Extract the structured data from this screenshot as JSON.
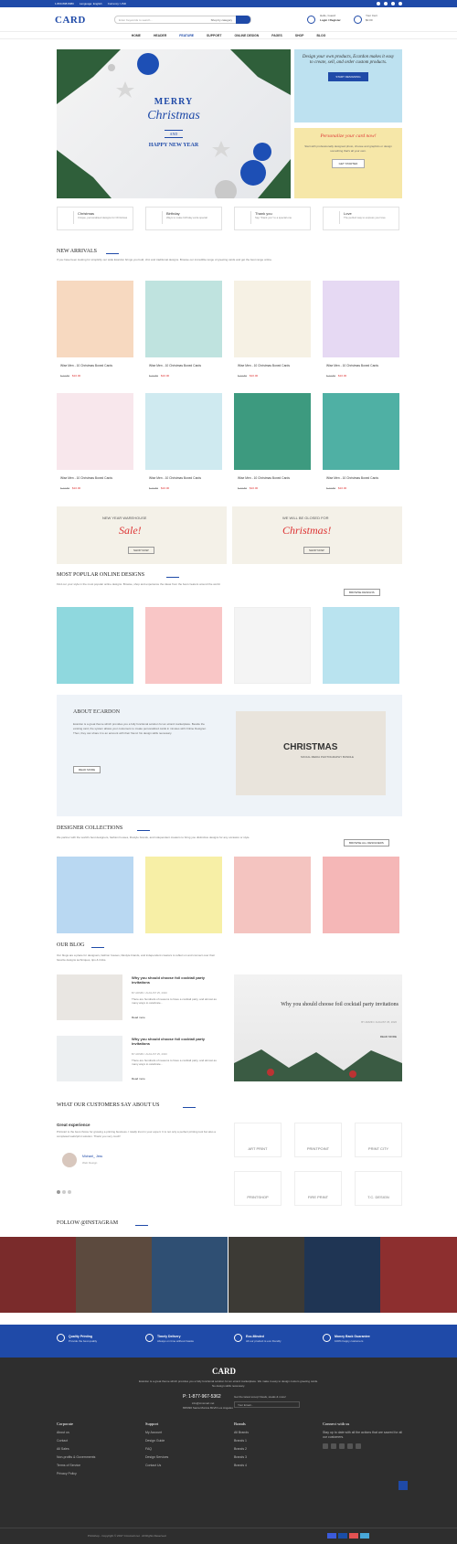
{
  "topbar": {
    "phone": "1.800.808.8080",
    "language": "Language: English",
    "currency": "Currency: USD"
  },
  "header": {
    "logo": "CARD",
    "search_placeholder": "Enter Keywords to search...",
    "category": "Shop by category",
    "account_hello": "Hello, Guest!",
    "account_links": "Login / Register",
    "cart_label": "Your Cart",
    "cart_total": "$0.00"
  },
  "nav": [
    "HOME",
    "HEADER",
    "FEATURE",
    "SUPPORT",
    "ONLINE DESIGN",
    "PAGES",
    "SHOP",
    "BLOG"
  ],
  "hero": {
    "title1": "MERRY",
    "title2": "Christmas",
    "title3": "AND",
    "title4": "HAPPY NEW YEAR"
  },
  "promo1": {
    "heading": "Design your own products, Ecardon makes it easy to create, sell, and order custom products.",
    "button": "START DESIGNING"
  },
  "promo2": {
    "heading": "Personalize your card now!",
    "text": "Start with professionally designed photo, choose and graphics or design something that's all your own.",
    "button": "GET STARTED"
  },
  "features": [
    {
      "title": "Christmas",
      "text": "Unique, personalised designs for Christmas"
    },
    {
      "title": "Birthday",
      "text": "Ways to make birthday extra special"
    },
    {
      "title": "Thank you",
      "text": "Say \"thank you\" to a special one"
    },
    {
      "title": "Love",
      "text": "The perfect way to express your love"
    }
  ],
  "new_arrivals": {
    "title": "NEW ARRIVALS",
    "desc": "If you have been looking for simplicity our wide Ecardon brings you bold, chic and traditional designs. Browse our incredible range of greeting cards and get the best range online."
  },
  "products": [
    {
      "title": "Wise Men - 10 Christmas Boxed Cards",
      "old": "$ 12.80",
      "price": "$10.00"
    },
    {
      "title": "Wise Men - 10 Christmas Boxed Cards",
      "old": "$ 12.80",
      "price": "$10.00"
    },
    {
      "title": "Wise Men - 10 Christmas Boxed Cards",
      "old": "$ 12.80",
      "price": "$10.00"
    },
    {
      "title": "Wise Men - 10 Christmas Boxed Cards",
      "old": "$ 12.80",
      "price": "$10.00"
    },
    {
      "title": "Wise Men - 10 Christmas Boxed Cards",
      "old": "$ 12.80",
      "price": "$10.00"
    },
    {
      "title": "Wise Men - 10 Christmas Boxed Cards",
      "old": "$ 12.80",
      "price": "$10.00"
    },
    {
      "title": "Wise Men - 10 Christmas Boxed Cards",
      "old": "$ 12.80",
      "price": "$10.00"
    },
    {
      "title": "Wise Men - 10 Christmas Boxed Cards",
      "old": "$ 12.80",
      "price": "$10.00"
    }
  ],
  "banners": [
    {
      "top": "NEW YEAR WAREHOUSE",
      "main": "Sale!",
      "btn": "SHOP NOW"
    },
    {
      "top": "WE WILL BE GLOSED FOR",
      "main": "Christmas!",
      "btn": "SHOP NOW"
    }
  ],
  "popular": {
    "title": "MOST POPULAR ONLINE DESIGNS",
    "desc": "Find our your style in the most popular online designs. Browse, shop and experience the ideas from the best creators around the world.",
    "button": "BROWSE DESIGNS"
  },
  "about": {
    "title": "ABOUT ECARDON",
    "text": "Ecardon is a great theme which provides you a fully functional solution for an eCard marketplace. Beside the existing card, the system allows your customers to create personalized cards in minutes with Online Designer. Then, they can share it to an account with their friend. No design skills necessary.",
    "button": "READ MORE",
    "image_title": "CHRISTMAS",
    "image_sub": "SOCIAL MEDIA PHOTOGRAPHY BUNDLE"
  },
  "designers": {
    "title": "DESIGNER COLLECTIONS",
    "desc": "We partner with the world's best designers, fashion houses, lifestyle brands, and independent creators to bring you distinctive designs for any occasion or style.",
    "button": "BROWSE ALL DESIGNERS"
  },
  "blog": {
    "title": "OUR BLOG",
    "desc": "Our blogs are a place for designers, fashion houses, lifestyle brands, and independent creators to reflect on and connect over their favorite designs techniques, tips & tricks.",
    "post_title": "Why you should choose foil cocktail party invitations",
    "meta": "BY ADMIN / AUGUST 25, 2020",
    "excerpt": "There are hundreds of reasons to have a cocktail party, and almost as many ways to celebrate...",
    "read": "Read more",
    "feature_title": "Why you should choose foil cocktail party invitations",
    "feature_meta": "BY ADMIN / AUGUST 25, 2020",
    "feature_btn": "READ MORE"
  },
  "testimonial": {
    "title": "WHAT OUR CUSTOMERS SAY ABOUT US",
    "heading": "Great experience",
    "quote": "Printcart is the best choice for growing a printing business. I totally trust in your expert. It is not only a perfect printing tool but also a completed web2print solution. Thank you very much!",
    "name": "Michael_ Jess",
    "role": "Web Design"
  },
  "brands": [
    "ART PRINT",
    "PRINTPOINT",
    "PRINT CITY",
    "PRINTSHOP",
    "FIRE PRINT",
    "T.C. DESIGN"
  ],
  "instagram": {
    "title": "FOLLOW @INSTAGRAM"
  },
  "benefits": [
    {
      "t": "Quality Printing",
      "s": "Provide the best quality"
    },
    {
      "t": "Timely Delivery",
      "s": "Always on time without hassle"
    },
    {
      "t": "Eco-Minded",
      "s": "All our product is eco friendly"
    },
    {
      "t": "Money Back Guarantee",
      "s": "100% happy customers"
    }
  ],
  "footer": {
    "logo": "CARD",
    "about": "Ecardon is a great theme which provides you a fully functional solution for an eCard marketplace. We make it easy to design custom greeting cards. No design skills necessary.",
    "phone": "P: 1-877-967-5362",
    "email": "info@cmsmart.net",
    "address": "835390 Santa Monica BLVD Los Angeles",
    "newsletter": "Get the latest scoop! Deals, steals & more!",
    "email_placeholder": "Your Email...",
    "corporate": {
      "title": "Corporate",
      "items": [
        "About us",
        "Contact",
        "All Sales",
        "Non-profits & Governments",
        "Terms of Service",
        "Privacy Policy"
      ]
    },
    "support": {
      "title": "Support",
      "items": [
        "My Account",
        "Design Guide",
        "FAQ",
        "Design Services",
        "Contact Us"
      ]
    },
    "brands": {
      "title": "Brands",
      "items": [
        "All Brands",
        "Brands 1",
        "Brands 2",
        "Brands 3",
        "Brands 4"
      ]
    },
    "connect": {
      "title": "Connect with us",
      "text": "Stay up to date with all the actions that are sacred for all our customers."
    },
    "copyright": "Printshop - Copyright © 2017 Cmsmart.net . All Rights Reserved."
  },
  "colors": {
    "brand": "#1f4aa8",
    "footer": "#2e2e2e"
  }
}
